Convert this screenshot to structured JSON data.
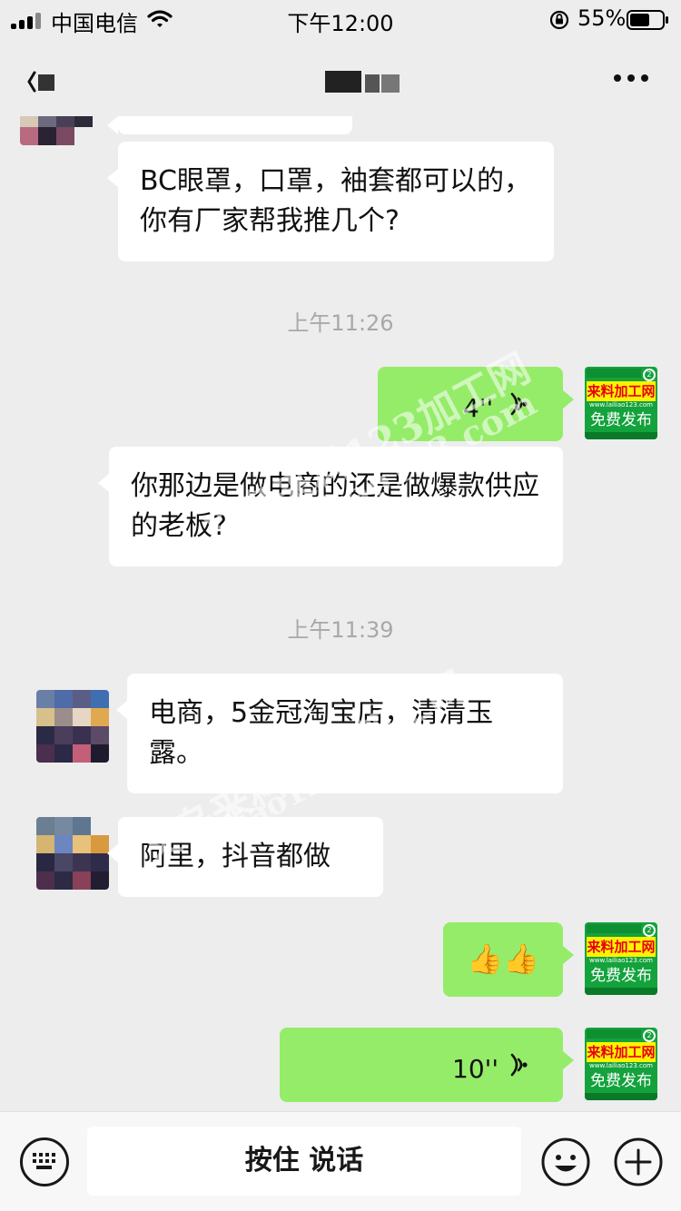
{
  "status_bar": {
    "carrier": "中国电信",
    "time": "下午12:00",
    "battery": "55%"
  },
  "nav": {
    "title": "",
    "more_icon": "more-dots-icon",
    "back_icon": "back-chevron-icon"
  },
  "chat": {
    "messages": [
      {
        "side": "left",
        "type": "text",
        "text": "BC眼罩，口罩，袖套都可以的，你有厂家帮我推几个?"
      },
      {
        "type": "timestamp",
        "text": "上午11:26"
      },
      {
        "side": "right",
        "type": "voice",
        "duration": "4''"
      },
      {
        "side": "left",
        "type": "text",
        "text": "你那边是做电商的还是做爆款供应的老板?"
      },
      {
        "type": "timestamp",
        "text": "上午11:39"
      },
      {
        "side": "left",
        "type": "text",
        "text": "电商，5金冠淘宝店，清清玉露。"
      },
      {
        "side": "left",
        "type": "text",
        "text": "阿里，抖音都做"
      },
      {
        "side": "right",
        "type": "emoji",
        "text": "👍👍"
      },
      {
        "side": "right",
        "type": "voice",
        "duration": "10''"
      }
    ],
    "self_avatar": {
      "title": "来料加工网",
      "url": "www.lailiao123.com",
      "promo": "免费发布"
    }
  },
  "input_bar": {
    "hold_to_talk": "按住 说话",
    "keyboard_icon": "keyboard-icon",
    "emoji_icon": "emoji-icon",
    "plus_icon": "plus-icon"
  },
  "watermark": {
    "line1": "义乌来料123加工网",
    "line2": "lailiao123.com"
  },
  "colors": {
    "background": "#ededed",
    "self_bubble": "#95ec69",
    "other_bubble": "#ffffff",
    "timestamp": "#a8a8a8"
  }
}
